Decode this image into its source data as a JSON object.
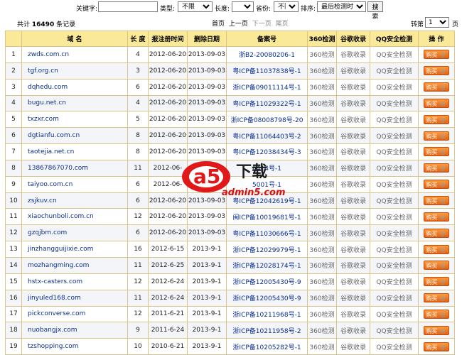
{
  "filters": {
    "keyword_label": "关键字:",
    "keyword_value": "",
    "type_label": "类型:",
    "type_value": "不限",
    "length_label": "长度:",
    "length_value": "",
    "province_label": "省份:",
    "province_value": "不限",
    "sort_label": "排序:",
    "sort_value": "最后检测时间",
    "search_button": "搜索"
  },
  "info": {
    "total_prefix": "共计",
    "total_count": "16490",
    "total_suffix": "条记录",
    "first_page": "首页",
    "prev_page": "上一页",
    "next_page": "下一页",
    "last_page": "尾页",
    "jump_label": "转第",
    "jump_value": "1",
    "page_unit": "页"
  },
  "table": {
    "headers": [
      "",
      "域 名",
      "长 度",
      "报注册时间",
      "删除日期",
      "备案号",
      "360检测",
      "谷歌收录",
      "QQ安全检测",
      "操 作"
    ],
    "check360": "360检测",
    "google": "谷歌收录",
    "qq": "QQ安全检测",
    "buy": "购买",
    "rows": [
      {
        "n": "1",
        "domain": "zwds.com.cn",
        "len": "4",
        "reg": "2012-06-20",
        "del": "2013-09-03",
        "icp": "浙B2-20080206-1"
      },
      {
        "n": "2",
        "domain": "tgf.org.cn",
        "len": "3",
        "reg": "2012-06-20",
        "del": "2013-09-03",
        "icp": "粤ICP备11037838号-1"
      },
      {
        "n": "3",
        "domain": "dqhedu.com",
        "len": "6",
        "reg": "2012-06-20",
        "del": "2013-09-03",
        "icp": "浙ICP备09011114号-1"
      },
      {
        "n": "4",
        "domain": "bugu.net.cn",
        "len": "4",
        "reg": "2012-06-20",
        "del": "2013-09-03",
        "icp": "粤ICP备11029322号-1"
      },
      {
        "n": "5",
        "domain": "txzxr.com",
        "len": "5",
        "reg": "2012-06-20",
        "del": "2013-09-03",
        "icp": "浙ICP备08008798号-20"
      },
      {
        "n": "6",
        "domain": "dgtianfu.com.cn",
        "len": "8",
        "reg": "2012-06-20",
        "del": "2013-09-03",
        "icp": "粤ICP备11064403号-2"
      },
      {
        "n": "7",
        "domain": "taotejia.net.cn",
        "len": "8",
        "reg": "2012-06-20",
        "del": "2013-09-03",
        "icp": "粤ICP备12038434号-3"
      },
      {
        "n": "8",
        "domain": "13867867070.com",
        "len": "11",
        "reg": "2012-06-",
        "del": "",
        "icp": "6414号-1"
      },
      {
        "n": "9",
        "domain": "taiyoo.com.cn",
        "len": "6",
        "reg": "2012-06-",
        "del": "",
        "icp": "5001号-1"
      },
      {
        "n": "10",
        "domain": "zsjkuv.cn",
        "len": "6",
        "reg": "2012-06-20",
        "del": "2013-09-03",
        "icp": "粤ICP备12042619号-1"
      },
      {
        "n": "11",
        "domain": "xiaochunboli.com.cn",
        "len": "12",
        "reg": "2012-06-20",
        "del": "2013-09-03",
        "icp": "闽ICP备10019681号-1"
      },
      {
        "n": "12",
        "domain": "gzqjbm.com",
        "len": "6",
        "reg": "2012-06-20",
        "del": "2013-09-03",
        "icp": "粤ICP备11030666号-1"
      },
      {
        "n": "13",
        "domain": "jinzhangguijixie.com",
        "len": "16",
        "reg": "2012-6-15",
        "del": "2013-9-1",
        "icp": "浙ICP备12029979号-1"
      },
      {
        "n": "14",
        "domain": "mozhangming.com",
        "len": "11",
        "reg": "2012-6-25",
        "del": "2013-9-1",
        "icp": "浙ICP备12028174号-1"
      },
      {
        "n": "15",
        "domain": "hstx-casters.com",
        "len": "12",
        "reg": "2012-6-24",
        "del": "2013-9-1",
        "icp": "浙ICP备12005430号-9"
      },
      {
        "n": "16",
        "domain": "jinyuled168.com",
        "len": "11",
        "reg": "2012-6-24",
        "del": "2013-9-1",
        "icp": "浙ICP备12005430号-9"
      },
      {
        "n": "17",
        "domain": "pickconverse.com",
        "len": "12",
        "reg": "2011-6-21",
        "del": "2013-9-1",
        "icp": "浙ICP备10211968号-1"
      },
      {
        "n": "18",
        "domain": "nuobangjx.com",
        "len": "9",
        "reg": "2011-6-24",
        "del": "2013-9-1",
        "icp": "浙ICP备10211958号-2"
      },
      {
        "n": "19",
        "domain": "tzshopping.com",
        "len": "10",
        "reg": "2010-6-21",
        "del": "2013-9-1",
        "icp": "浙ICP备10205282号-1"
      }
    ]
  },
  "watermark": {
    "logo_text": "a5",
    "brand_text": "下载",
    "site_text": "admin5.com"
  }
}
